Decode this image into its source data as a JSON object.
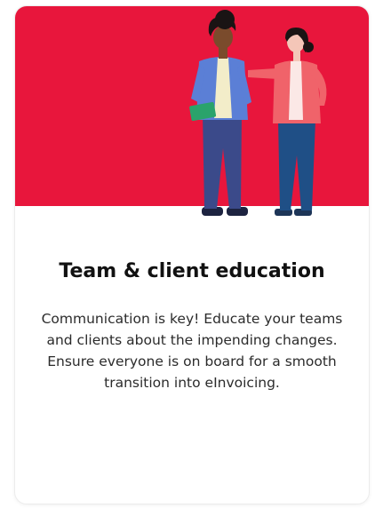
{
  "card": {
    "title": "Team & client education",
    "description": "Communication is key! Educate your teams and clients about the impending changes. Ensure everyone is on board for a smooth transition into eInvoicing.",
    "illustration_icon": "two-people-talking-illustration",
    "colors": {
      "accent": "#e8163c",
      "background": "#ffffff",
      "title": "#111111",
      "text": "#2b2b2b"
    }
  }
}
